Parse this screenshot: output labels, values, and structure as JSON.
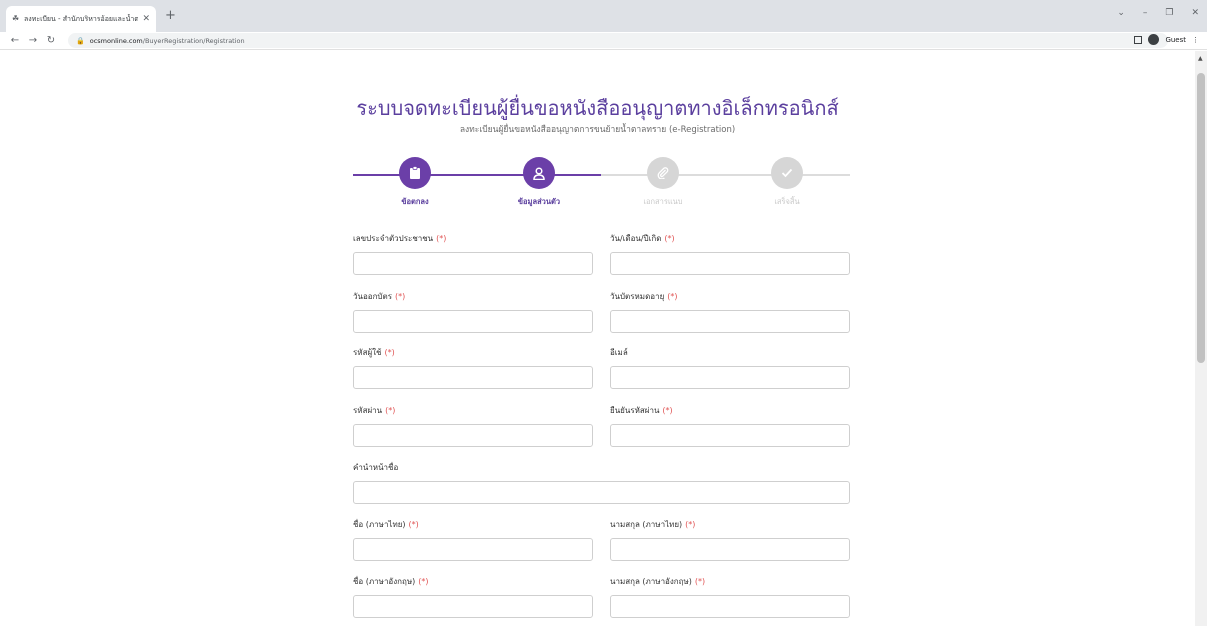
{
  "browser": {
    "tab_title": "ลงทะเบียน - สำนักบริหารอ้อยและน้ำตาล",
    "url_host": "ocsmonline.com",
    "url_path": "/BuyerRegistration/Registration",
    "profile_label": "Guest"
  },
  "page": {
    "title": "ระบบจดทะเบียนผู้ยื่นขอหนังสืออนุญาตทางอิเล็กทรอนิกส์",
    "subtitle": "ลงทะเบียนผู้ยื่นขอหนังสืออนุญาตการขนย้ายน้ำตาลทราย (e-Registration)"
  },
  "stepper": {
    "steps": [
      {
        "label": "ข้อตกลง",
        "icon": "clipboard-icon",
        "state": "done"
      },
      {
        "label": "ข้อมูลส่วนตัว",
        "icon": "user-icon",
        "state": "active"
      },
      {
        "label": "เอกสารแนบ",
        "icon": "paperclip-icon",
        "state": "inactive"
      },
      {
        "label": "เสร็จสิ้น",
        "icon": "check-icon",
        "state": "inactive"
      }
    ]
  },
  "form": {
    "required_mark": "(*)",
    "fields": [
      {
        "key": "citizen_id",
        "label": "เลขประจำตัวประชาชน",
        "required": true,
        "value": ""
      },
      {
        "key": "birth_date",
        "label": "วัน/เดือน/ปีเกิด",
        "required": true,
        "value": ""
      },
      {
        "key": "issue_date",
        "label": "วันออกบัตร",
        "required": true,
        "value": ""
      },
      {
        "key": "expiry_date",
        "label": "วันบัตรหมดอายุ",
        "required": true,
        "value": ""
      },
      {
        "key": "username",
        "label": "รหัสผู้ใช้",
        "required": true,
        "value": ""
      },
      {
        "key": "email",
        "label": "อีเมล์",
        "required": false,
        "value": ""
      },
      {
        "key": "password",
        "label": "รหัสผ่าน",
        "required": true,
        "value": ""
      },
      {
        "key": "confirm_password",
        "label": "ยืนยันรหัสผ่าน",
        "required": true,
        "value": ""
      },
      {
        "key": "name_prefix",
        "label": "คำนำหน้าชื่อ",
        "required": false,
        "value": ""
      },
      {
        "key": "first_name_th",
        "label": "ชื่อ (ภาษาไทย)",
        "required": true,
        "value": ""
      },
      {
        "key": "last_name_th",
        "label": "นามสกุล (ภาษาไทย)",
        "required": true,
        "value": ""
      },
      {
        "key": "first_name_en",
        "label": "ชื่อ (ภาษาอังกฤษ)",
        "required": true,
        "value": ""
      },
      {
        "key": "last_name_en",
        "label": "นามสกุล (ภาษาอังกฤษ)",
        "required": true,
        "value": ""
      }
    ]
  },
  "colors": {
    "primary": "#6b3fa8",
    "title": "#5b3f9e",
    "required": "#e05252",
    "inactive": "#d6d6d6"
  }
}
